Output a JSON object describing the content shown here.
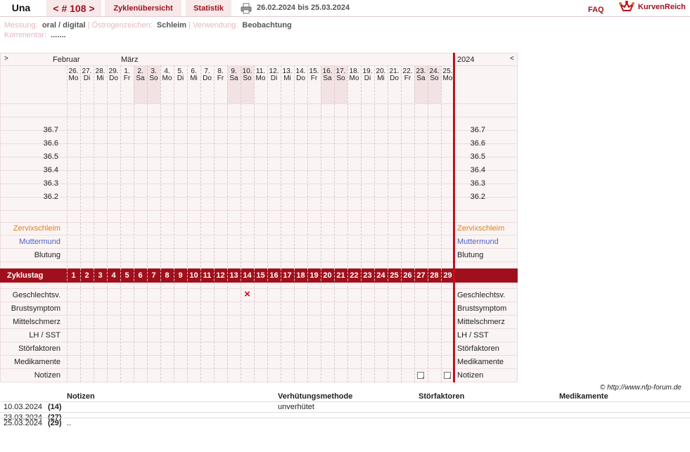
{
  "header": {
    "name": "Una",
    "cycle": "< # 108 >",
    "tab_overview": "Zyklenübersicht",
    "tab_stats": "Statistik",
    "date_range": "26.02.2024 bis 25.03.2024",
    "faq": "FAQ",
    "logo_text": "KurvenReich"
  },
  "meta": {
    "messung_label": "Messung:",
    "messung_value": "oral / digital",
    "oestrogen_label": "Östrogenzeichen:",
    "oestrogen_value": "Schleim",
    "verwendung_label": "Verwendung:",
    "verwendung_value": "Beobachtung",
    "kommentar_label": "Kommentar:",
    "kommentar_value": "......."
  },
  "chart": {
    "nav_left": ">",
    "nav_right": "<",
    "month1": "Februar",
    "month2": "März",
    "year": "2024",
    "days": [
      {
        "d": "26.",
        "w": "Mo"
      },
      {
        "d": "27.",
        "w": "Di"
      },
      {
        "d": "28.",
        "w": "Mi"
      },
      {
        "d": "29.",
        "w": "Do"
      },
      {
        "d": "1.",
        "w": "Fr"
      },
      {
        "d": "2.",
        "w": "Sa"
      },
      {
        "d": "3.",
        "w": "So"
      },
      {
        "d": "4.",
        "w": "Mo"
      },
      {
        "d": "5.",
        "w": "Di"
      },
      {
        "d": "6.",
        "w": "Mi"
      },
      {
        "d": "7.",
        "w": "Do"
      },
      {
        "d": "8.",
        "w": "Fr"
      },
      {
        "d": "9.",
        "w": "Sa"
      },
      {
        "d": "10.",
        "w": "So"
      },
      {
        "d": "11.",
        "w": "Mo"
      },
      {
        "d": "12.",
        "w": "Di"
      },
      {
        "d": "13.",
        "w": "Mi"
      },
      {
        "d": "14.",
        "w": "Do"
      },
      {
        "d": "15.",
        "w": "Fr"
      },
      {
        "d": "16.",
        "w": "Sa"
      },
      {
        "d": "17.",
        "w": "So"
      },
      {
        "d": "18.",
        "w": "Mo"
      },
      {
        "d": "19.",
        "w": "Di"
      },
      {
        "d": "20.",
        "w": "Mi"
      },
      {
        "d": "21.",
        "w": "Do"
      },
      {
        "d": "22.",
        "w": "Fr"
      },
      {
        "d": "23.",
        "w": "Sa"
      },
      {
        "d": "24.",
        "w": "So"
      },
      {
        "d": "25.",
        "w": "Mo"
      }
    ],
    "temps": [
      "36.7",
      "36.6",
      "36.5",
      "36.4",
      "36.3",
      "36.2"
    ],
    "rows_top": [
      {
        "label": "Zervixschleim",
        "color": "#e08020"
      },
      {
        "label": "Muttermund",
        "color": "#5060c0"
      },
      {
        "label": "Blutung",
        "color": "#222222"
      }
    ],
    "cycle_label": "Zyklustag",
    "cycle_days": [
      "1",
      "2",
      "3",
      "4",
      "5",
      "6",
      "7",
      "8",
      "9",
      "10",
      "11",
      "12",
      "13",
      "14",
      "15",
      "16",
      "17",
      "18",
      "19",
      "20",
      "21",
      "22",
      "23",
      "24",
      "25",
      "26",
      "27",
      "28",
      "29"
    ],
    "rows_bottom": [
      "Geschlechtsv.",
      "Brustsymptom",
      "Mittelschmerz",
      "LH / SST",
      "Störfaktoren",
      "Medikamente",
      "Notizen"
    ],
    "intercourse_mark": "×",
    "intercourse_day": 14,
    "note_days": [
      27,
      29
    ],
    "copyright": "© http://www.nfp-forum.de"
  },
  "bottom_table": {
    "headers": [
      "Notizen",
      "Verhütungsmethode",
      "Störfaktoren",
      "Medikamente"
    ],
    "rows": [
      {
        "date": "10.03.2024",
        "day": "(14)",
        "notes": "",
        "method": "unverhütet"
      },
      {
        "date": "23.03.2024",
        "day": "(27)",
        "notes": "",
        "method": ""
      },
      {
        "date": "25.03.2024",
        "day": "(29)",
        "notes": "..",
        "method": ""
      }
    ]
  }
}
